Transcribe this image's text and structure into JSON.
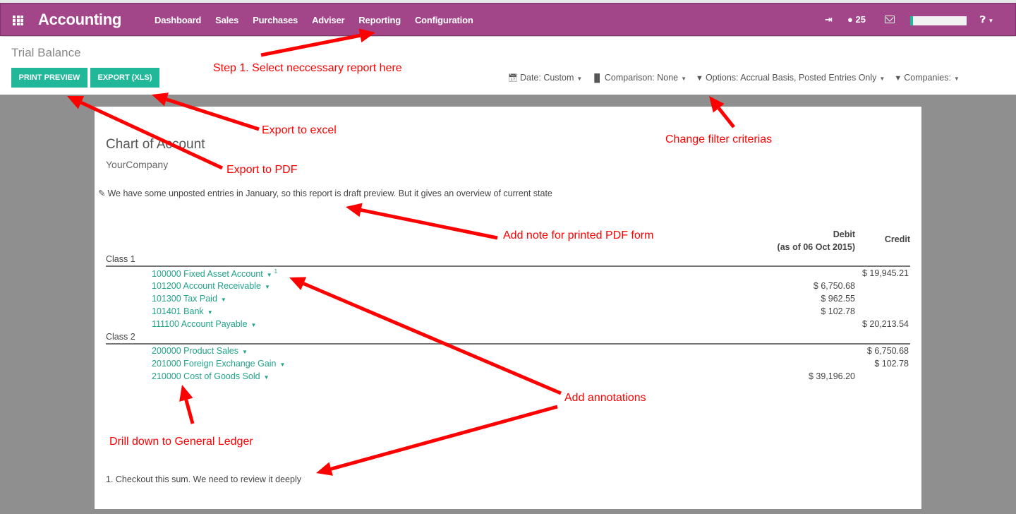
{
  "navbar": {
    "app_title": "Accounting",
    "menu": [
      "Dashboard",
      "Sales",
      "Purchases",
      "Adviser",
      "Reporting",
      "Configuration"
    ],
    "signin_icon": "sign-in-icon",
    "chat_count": "25",
    "help_icon": "question-circle-icon",
    "brand_color": "#a24689"
  },
  "page": {
    "title": "Trial Balance",
    "buttons": {
      "print_preview": "PRINT PREVIEW",
      "export_xls": "EXPORT (XLS)"
    },
    "accent_color": "#21b799",
    "filters": [
      {
        "icon": "calendar-icon",
        "label": "Date: Custom"
      },
      {
        "icon": "bar-chart-icon",
        "label": "Comparison: None"
      },
      {
        "icon": "filter-icon",
        "label": "Options: Accrual Basis, Posted Entries Only"
      },
      {
        "icon": "filter-icon",
        "label": "Companies:"
      }
    ]
  },
  "report": {
    "title": "Chart of Account",
    "company": "YourCompany",
    "note": "We have some unposted entries in January, so this report is draft preview. But it gives an overview of current state",
    "columns": {
      "debit": "Debit",
      "debit_sub": "(as of 06 Oct 2015)",
      "credit": "Credit"
    },
    "classes": [
      {
        "label": "Class 1",
        "accounts": [
          {
            "name": "100000 Fixed Asset Account",
            "footnote": "1",
            "debit": "",
            "credit": "$ 19,945.21"
          },
          {
            "name": "101200 Account Receivable",
            "footnote": "",
            "debit": "$ 6,750.68",
            "credit": ""
          },
          {
            "name": "101300 Tax Paid",
            "footnote": "",
            "debit": "$ 962.55",
            "credit": ""
          },
          {
            "name": "101401 Bank",
            "footnote": "",
            "debit": "$ 102.78",
            "credit": ""
          },
          {
            "name": "111100 Account Payable",
            "footnote": "",
            "debit": "",
            "credit": "$ 20,213.54"
          }
        ]
      },
      {
        "label": "Class 2",
        "accounts": [
          {
            "name": "200000 Product Sales",
            "footnote": "",
            "debit": "",
            "credit": "$ 6,750.68"
          },
          {
            "name": "201000 Foreign Exchange Gain",
            "footnote": "",
            "debit": "",
            "credit": "$ 102.78"
          },
          {
            "name": "210000 Cost of Goods Sold",
            "footnote": "",
            "debit": "$ 39,196.20",
            "credit": ""
          }
        ]
      }
    ],
    "footnote_text": "1. Checkout this sum. We need to review it deeply"
  },
  "annotations": {
    "step1": "Step 1. Select neccessary report here",
    "export_excel": "Export to excel",
    "export_pdf": "Export to PDF",
    "filters": "Change filter criterias",
    "note": "Add note for printed PDF form",
    "annotations": "Add annotations",
    "drilldown": "Drill down to General Ledger",
    "color": "#ff0000"
  }
}
